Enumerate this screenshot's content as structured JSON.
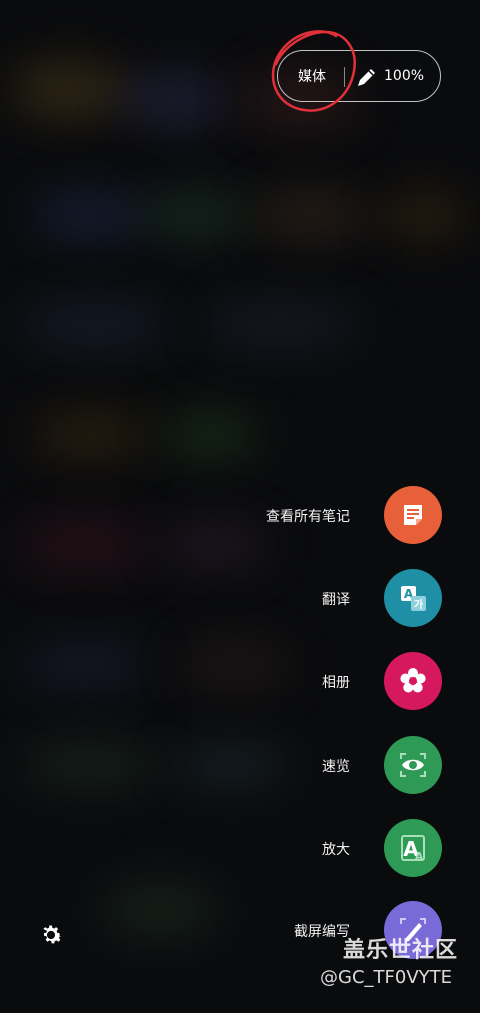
{
  "top_pill": {
    "mode_label": "媒体",
    "pen_icon": "pen-icon",
    "battery_label": "100%"
  },
  "menu": {
    "items": [
      {
        "label": "查看所有笔记",
        "icon": "notes-icon",
        "color": "#e8603a"
      },
      {
        "label": "翻译",
        "icon": "translate-icon",
        "color": "#1f8fa6"
      },
      {
        "label": "相册",
        "icon": "flower-icon",
        "color": "#d6195f"
      },
      {
        "label": "速览",
        "icon": "eye-icon",
        "color": "#2e9a55"
      },
      {
        "label": "放大",
        "icon": "magnify-text-icon",
        "color": "#2e9a55"
      },
      {
        "label": "截屏编写",
        "icon": "screen-write-icon",
        "color": "#7a6ad8"
      }
    ]
  },
  "settings_icon": "gear-icon",
  "watermark": {
    "title": "盖乐世社区",
    "user": "@GC_TF0VYTE"
  }
}
